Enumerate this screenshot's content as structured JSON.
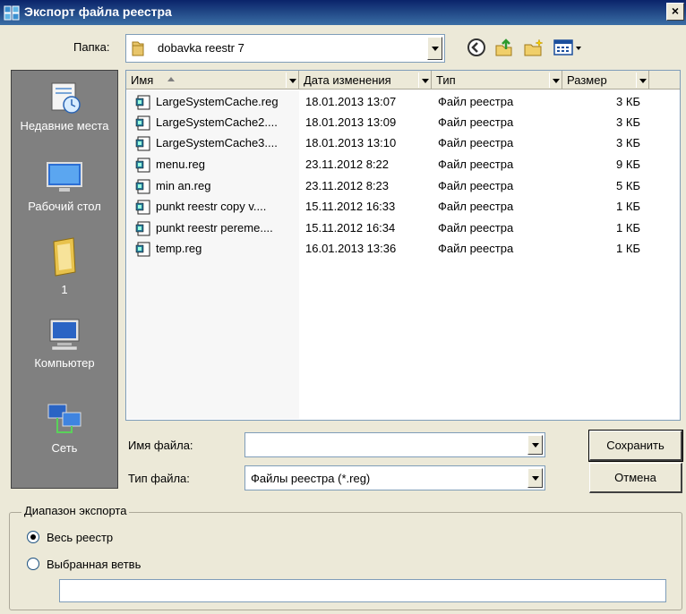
{
  "window": {
    "title": "Экспорт файла реестра",
    "close_label": "×"
  },
  "folder": {
    "label": "Папка:",
    "current": "dobavka reestr 7"
  },
  "toolbar_icons": [
    "back-icon",
    "up-folder-icon",
    "new-folder-icon",
    "view-menu-icon"
  ],
  "places": [
    {
      "label": "Недавние места",
      "icon": "recent-places-icon"
    },
    {
      "label": "Рабочий стол",
      "icon": "desktop-icon"
    },
    {
      "label": "1",
      "icon": "documents-folder-icon"
    },
    {
      "label": "Компьютер",
      "icon": "computer-icon"
    },
    {
      "label": "Сеть",
      "icon": "network-icon"
    }
  ],
  "columns": [
    "Имя",
    "Дата изменения",
    "Тип",
    "Размер"
  ],
  "files": [
    {
      "name": "LargeSystemCache.reg",
      "date": "18.01.2013 13:07",
      "type": "Файл реестра",
      "size": "3 КБ"
    },
    {
      "name": "LargeSystemCache2....",
      "date": "18.01.2013 13:09",
      "type": "Файл реестра",
      "size": "3 КБ"
    },
    {
      "name": "LargeSystemCache3....",
      "date": "18.01.2013 13:10",
      "type": "Файл реестра",
      "size": "3 КБ"
    },
    {
      "name": "menu.reg",
      "date": "23.11.2012 8:22",
      "type": "Файл реестра",
      "size": "9 КБ"
    },
    {
      "name": "min an.reg",
      "date": "23.11.2012 8:23",
      "type": "Файл реестра",
      "size": "5 КБ"
    },
    {
      "name": "punkt reestr copy v....",
      "date": "15.11.2012 16:33",
      "type": "Файл реестра",
      "size": "1 КБ"
    },
    {
      "name": "punkt reestr pereme....",
      "date": "15.11.2012 16:34",
      "type": "Файл реестра",
      "size": "1 КБ"
    },
    {
      "name": "temp.reg",
      "date": "16.01.2013 13:36",
      "type": "Файл реестра",
      "size": "1 КБ"
    }
  ],
  "filename": {
    "label": "Имя файла:",
    "value": ""
  },
  "filetype": {
    "label": "Тип файла:",
    "value": "Файлы реестра (*.reg)"
  },
  "buttons": {
    "save": "Сохранить",
    "cancel": "Отмена"
  },
  "export_range": {
    "legend": "Диапазон экспорта",
    "all_label": "Весь реестр",
    "branch_label": "Выбранная ветвь",
    "selected": "all",
    "branch_value": ""
  },
  "colors": {
    "titlebar": "#0a246a",
    "dialog_bg": "#ece9d8",
    "places_bg": "#808080"
  }
}
